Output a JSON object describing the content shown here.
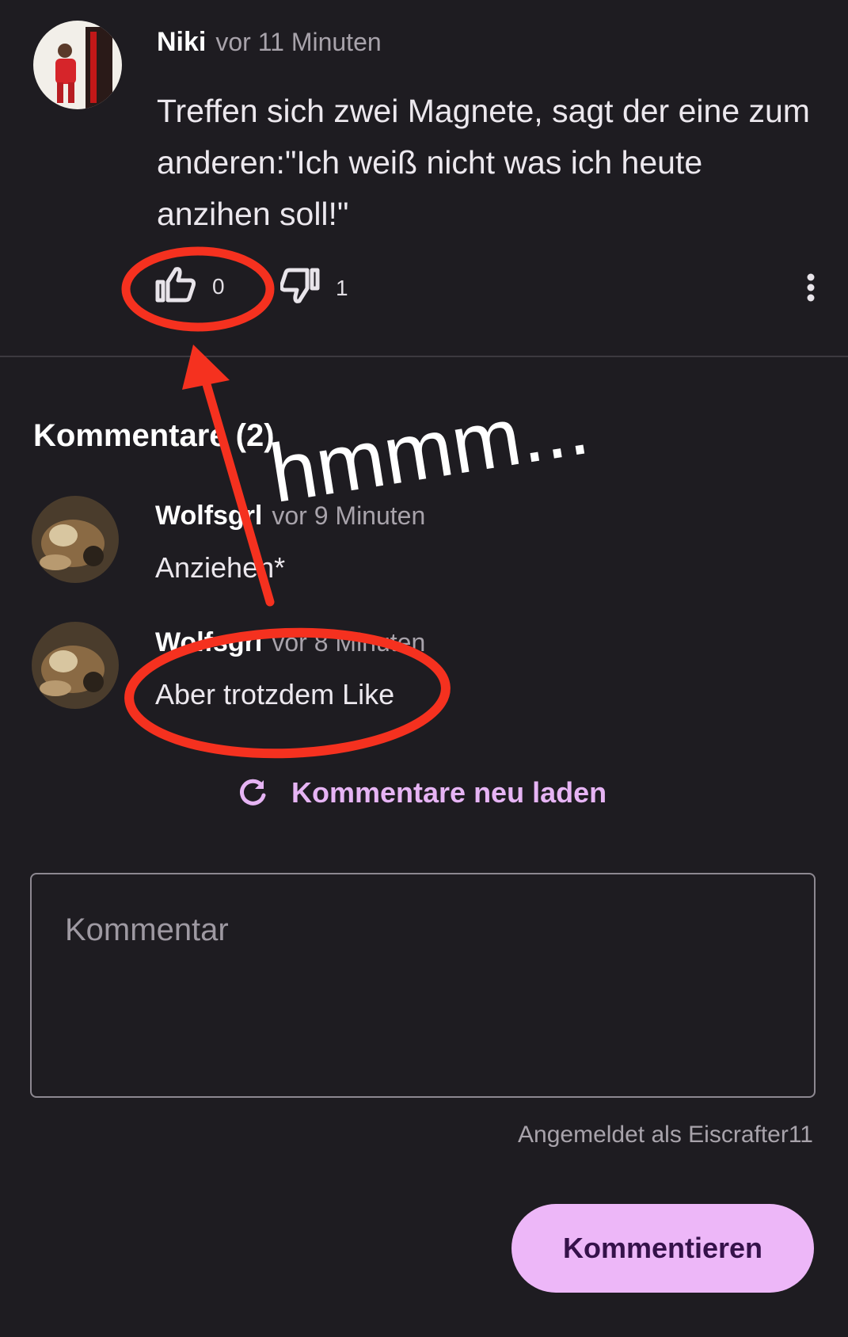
{
  "post": {
    "author": "Niki",
    "time": "vor 11 Minuten",
    "text": "Treffen sich zwei Magnete, sagt der eine zum anderen:\"Ich weiß nicht was ich heute anzihen soll!\"",
    "likes": "0",
    "dislikes": "1"
  },
  "comments_section": {
    "title": "Kommentare (2)",
    "items": [
      {
        "author": "Wolfsgrl",
        "time": "vor 9 Minuten",
        "text": "Anziehen*"
      },
      {
        "author": "Wolfsgrl",
        "time": "vor 8 Minuten",
        "text": "Aber trotzdem Like"
      }
    ],
    "reload_label": "Kommentare neu laden"
  },
  "comment_form": {
    "placeholder": "Kommentar",
    "logged_in_as": "Angemeldet als Eiscrafter11",
    "submit_label": "Kommentieren"
  },
  "annotation": {
    "text": "hmmm...",
    "color": "#f5311f"
  },
  "colors": {
    "background": "#1e1c21",
    "accent": "#e6b4f4",
    "button": "#edb7f8"
  }
}
